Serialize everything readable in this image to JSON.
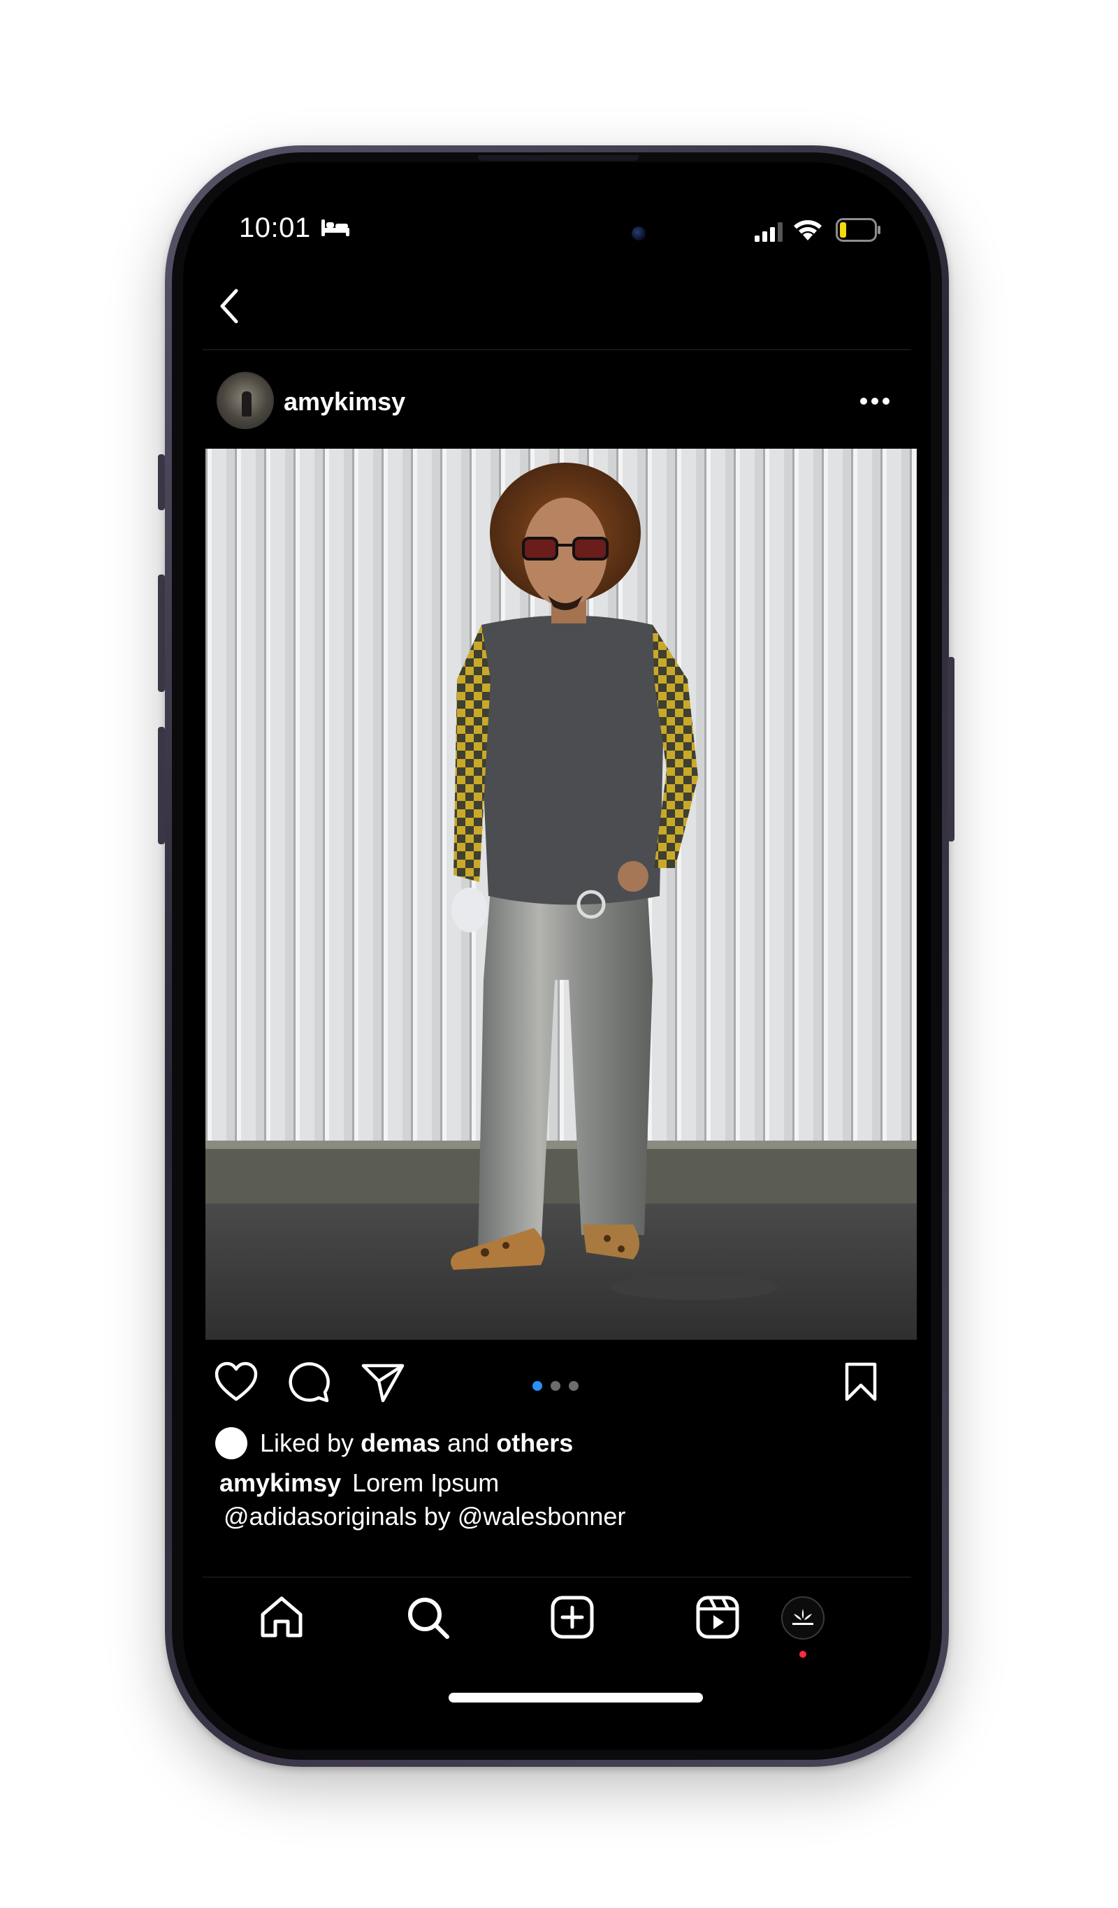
{
  "status_bar": {
    "time": "10:01",
    "icons": [
      "bed-icon",
      "signal-icon",
      "wifi-icon",
      "battery-low-icon"
    ],
    "battery_color": "#f5d90a"
  },
  "nav": {
    "back_icon": "chevron-left-icon"
  },
  "post": {
    "username": "amykimsy",
    "more_icon": "more-horizontal-icon",
    "carousel": {
      "total": 3,
      "active_index": 0,
      "active_color": "#2a8ff7"
    },
    "actions": [
      "heart-icon",
      "comment-icon",
      "share-icon",
      "bookmark-icon"
    ],
    "liked_by": {
      "prefix": "Liked by ",
      "name": "demas",
      "middle": " and ",
      "others": "others"
    },
    "caption": {
      "username": "amykimsy",
      "text": "Lorem Ipsum",
      "line2": "@adidasoriginals by @walesbonner"
    }
  },
  "tab_bar": {
    "items": [
      "home-icon",
      "search-icon",
      "create-icon",
      "reels-icon",
      "profile-adidas-icon"
    ],
    "notification_color": "#ff2a43"
  }
}
